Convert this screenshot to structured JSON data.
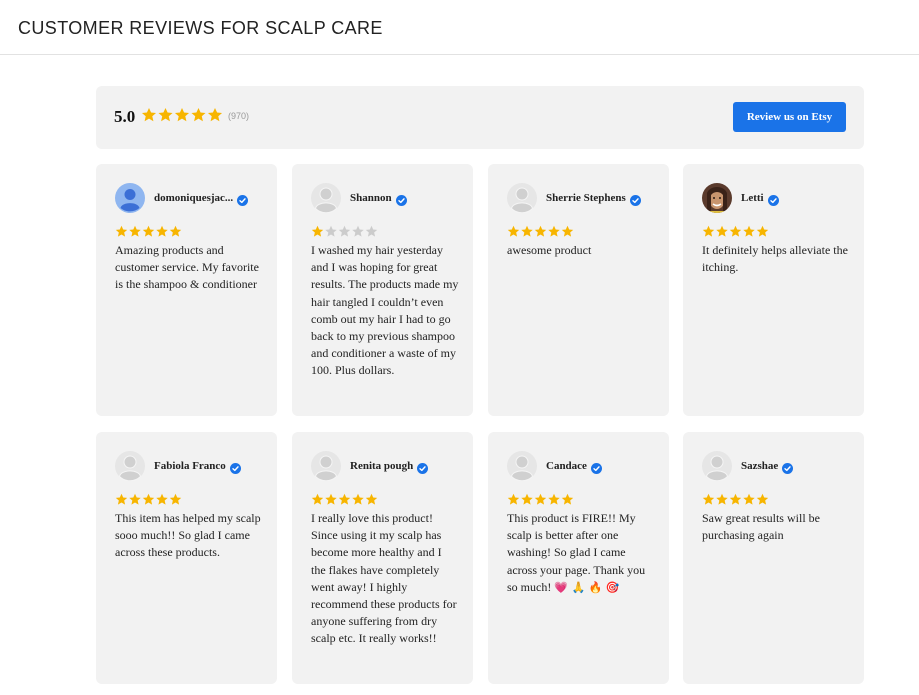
{
  "page": {
    "title": "CUSTOMER REVIEWS FOR SCALP CARE"
  },
  "summary": {
    "rating": "5.0",
    "stars": 5,
    "count": "(970)",
    "button_label": "Review us on Etsy"
  },
  "colors": {
    "star_filled": "#f7b500",
    "star_empty": "#cccccc",
    "verified": "#1a73e8",
    "button": "#1a73e8",
    "card_bg": "#f2f2f2"
  },
  "reviews": [
    {
      "name": "domoniquesjac...",
      "avatar": "default-blue-avatar-icon",
      "rating": 5,
      "text": "Amazing products and customer service. My favorite is the shampoo & conditioner"
    },
    {
      "name": "Shannon",
      "avatar": "grey-silhouette-avatar-icon",
      "rating": 1,
      "text": "I washed my hair yesterday and I was hoping for great results. The products made my hair tangled I couldn’t even comb out my hair I had to go back to my previous shampoo and conditioner a waste of my 100. Plus dollars."
    },
    {
      "name": "Sherrie Stephens",
      "avatar": "grey-silhouette-avatar-icon",
      "rating": 5,
      "text": "awesome product"
    },
    {
      "name": "Letti",
      "avatar": "photo-avatar-icon",
      "rating": 5,
      "text": "It definitely helps alleviate the itching."
    },
    {
      "name": "Fabiola Franco",
      "avatar": "grey-silhouette-avatar-icon",
      "rating": 5,
      "text": "This item has helped my scalp sooo much!! So glad I came across these products."
    },
    {
      "name": "Renita pough",
      "avatar": "grey-silhouette-avatar-icon",
      "rating": 5,
      "text": "I really love this product! Since using it my scalp has become more healthy and I the flakes have completely went away! I highly recommend these products for anyone suffering from dry scalp etc. It really works!!"
    },
    {
      "name": "Candace",
      "avatar": "grey-silhouette-avatar-icon",
      "rating": 5,
      "text": "This product is FIRE!! My scalp is better after one washing! So glad I came across your page. Thank you so much!",
      "emoji": "💗 🙏 🔥 🎯"
    },
    {
      "name": "Sazshae",
      "avatar": "grey-silhouette-avatar-icon",
      "rating": 5,
      "text": "Saw great results will be purchasing again"
    }
  ]
}
